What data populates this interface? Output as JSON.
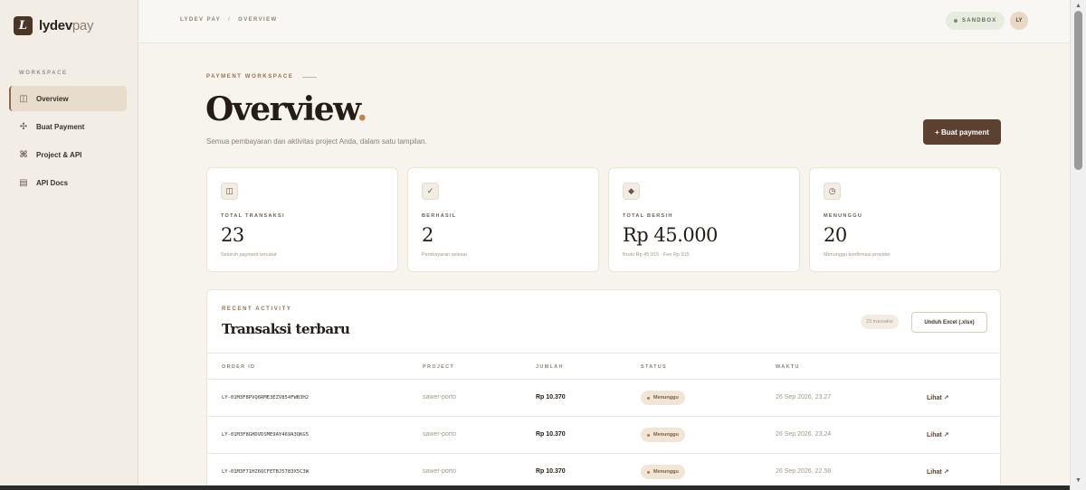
{
  "brand": {
    "mark": "L",
    "name_bold": "lydev",
    "name_light": "pay"
  },
  "sidebar": {
    "section": "WORKSPACE",
    "items": [
      {
        "label": "Overview",
        "icon": "columns-icon",
        "glyph": "◫",
        "active": true
      },
      {
        "label": "Buat Payment",
        "icon": "move-icon",
        "glyph": "✣",
        "active": false
      },
      {
        "label": "Project & API",
        "icon": "command-icon",
        "glyph": "⌘",
        "active": false
      },
      {
        "label": "API Docs",
        "icon": "document-icon",
        "glyph": "▤",
        "active": false
      }
    ]
  },
  "topbar": {
    "crumb_root": "LYDEV PAY",
    "crumb_sep": "/",
    "crumb_current": "OVERVIEW",
    "env_badge": "SANDBOX",
    "avatar": "LY"
  },
  "header": {
    "eyebrow": "PAYMENT WORKSPACE",
    "title": "Overview",
    "title_dot": ".",
    "subtitle": "Semua pembayaran dan aktivitas project Anda, dalam satu tampilan.",
    "cta": "+ Buat payment"
  },
  "stats": [
    {
      "label": "TOTAL TRANSAKSI",
      "value": "23",
      "note": "Seluruh payment tercatat",
      "icon": "columns-icon",
      "glyph": "◫"
    },
    {
      "label": "BERHASIL",
      "value": "2",
      "note": "Pembayaran selesai",
      "icon": "check-icon",
      "glyph": "✓"
    },
    {
      "label": "TOTAL BERSIH",
      "value": "Rp 45.000",
      "note": "Bruto Rp 45.915 · Fee Rp 915",
      "icon": "diamond-icon",
      "glyph": "◆"
    },
    {
      "label": "MENUNGGU",
      "value": "20",
      "note": "Menunggu konfirmasi provider",
      "icon": "clock-icon",
      "glyph": "◷"
    }
  ],
  "activity": {
    "eyebrow": "RECENT ACTIVITY",
    "title": "Transaksi terbaru",
    "count": "23 transaksi",
    "export": "Unduh Excel (.xlsx)",
    "columns": [
      "ORDER ID",
      "PROJECT",
      "JUMLAH",
      "STATUS",
      "WAKTU"
    ],
    "rows": [
      {
        "order": "LY-01M3F8PVQ6RME3EZV854FWB3H2",
        "project": "sawer-porto",
        "amount": "Rp 10.370",
        "status": "Menunggu",
        "time": "26 Sep 2026, 23.27",
        "action": "Lihat ↗"
      },
      {
        "order": "LY-01M3F8GHDVDSME9AY469A3QKG5",
        "project": "sawer-porto",
        "amount": "Rp 10.370",
        "status": "Menunggu",
        "time": "26 Sep 2026, 23.24",
        "action": "Lihat ↗"
      },
      {
        "order": "LY-01M3F71HZ6QCFETBJ5783X5C3W",
        "project": "sawer-porto",
        "amount": "Rp 10.370",
        "status": "Menunggu",
        "time": "26 Sep 2026, 22.58",
        "action": "Lihat ↗"
      }
    ]
  },
  "colors": {
    "accent": "#5c4131",
    "accent_dot": "#c1824f",
    "background": "#f7f4ee",
    "sidebar": "#f2ede5"
  }
}
